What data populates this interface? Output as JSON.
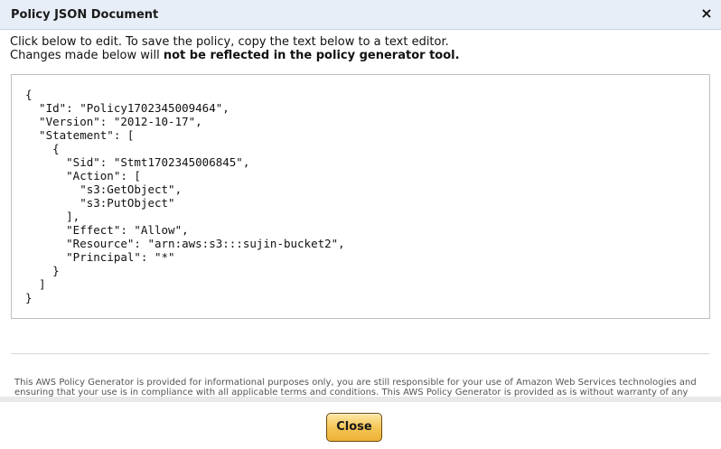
{
  "dialog": {
    "title": "Policy JSON Document",
    "close_glyph": "×"
  },
  "instructions": {
    "line1": "Click below to edit. To save the policy, copy the text below to a text editor.",
    "line2_prefix": "Changes made below will ",
    "line2_bold": "not be reflected in the policy generator tool."
  },
  "policy_text": "{\n  \"Id\": \"Policy1702345009464\",\n  \"Version\": \"2012-10-17\",\n  \"Statement\": [\n    {\n      \"Sid\": \"Stmt1702345006845\",\n      \"Action\": [\n        \"s3:GetObject\",\n        \"s3:PutObject\"\n      ],\n      \"Effect\": \"Allow\",\n      \"Resource\": \"arn:aws:s3:::sujin-bucket2\",\n      \"Principal\": \"*\"\n    }\n  ]\n}",
  "disclaimer": "This AWS Policy Generator is provided for informational purposes only, you are still responsible for your use of Amazon Web Services technologies and ensuring that your use is in compliance with all applicable terms and conditions. This AWS Policy Generator is provided as is without warranty of any kind, whether express",
  "footer": {
    "close_label": "Close"
  },
  "colors": {
    "titlebar": "#e8eef7",
    "button": "#f4c452",
    "border": "#bfbfbf"
  }
}
